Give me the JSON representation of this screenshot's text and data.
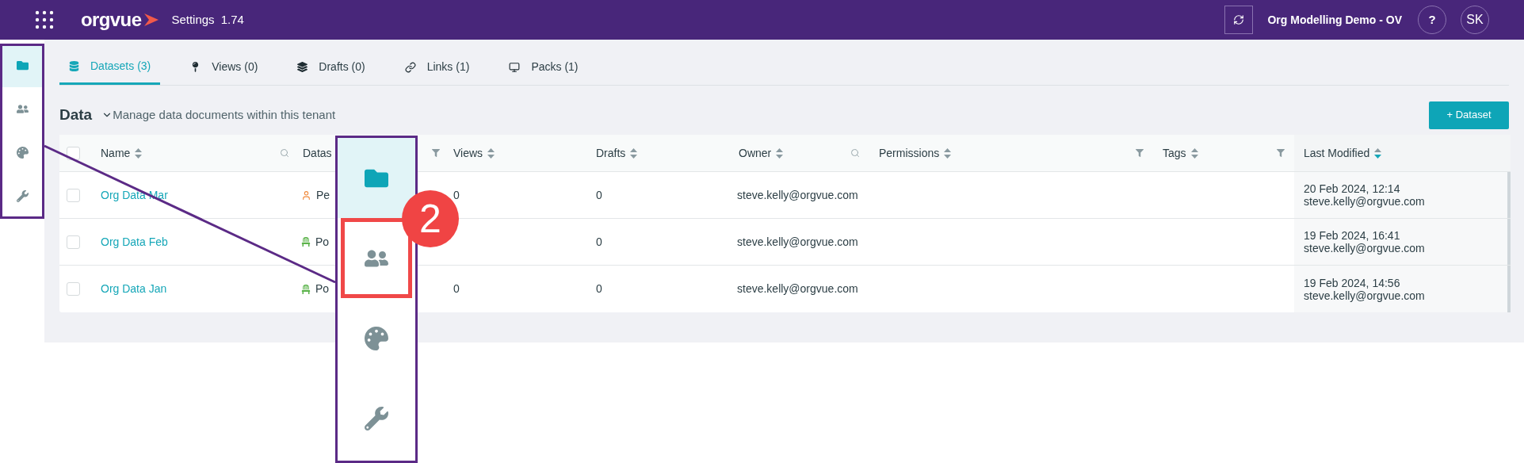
{
  "top_bar": {
    "app_name": "orgvue",
    "title": "Settings",
    "version": "1.74",
    "workspace": "Org Modelling Demo - OV",
    "help": "?",
    "avatar": "SK"
  },
  "sidebar": {
    "items": [
      {
        "kind": "folder",
        "selected": true
      },
      {
        "kind": "people",
        "selected": false
      },
      {
        "kind": "palette",
        "selected": false
      },
      {
        "kind": "wrench",
        "selected": false
      }
    ]
  },
  "tabs": [
    {
      "kind": "database",
      "label": "Datasets (3)",
      "selected": true
    },
    {
      "kind": "pin",
      "label": "Views (0)",
      "selected": false
    },
    {
      "kind": "layers",
      "label": "Drafts (0)",
      "selected": false
    },
    {
      "kind": "link",
      "label": "Links (1)",
      "selected": false
    },
    {
      "kind": "pack",
      "label": "Packs (1)",
      "selected": false
    }
  ],
  "heading": {
    "title": "Data",
    "description": "Manage data documents within this tenant"
  },
  "add_button": "+ Dataset",
  "table": {
    "select_all_checked": false,
    "columns": [
      {
        "label": "Name",
        "kind": "search",
        "sorted": false
      },
      {
        "label": "Datas",
        "kind": "filter"
      },
      {
        "label": "Views",
        "kind": "plain",
        "sorted": false
      },
      {
        "label": "Drafts",
        "kind": "plain",
        "sorted": false
      },
      {
        "label": "Owner",
        "kind": "search",
        "sorted": false
      },
      {
        "label": "Permissions",
        "kind": "filter",
        "sorted": false
      },
      {
        "label": "Tags",
        "kind": "filter",
        "sorted": false
      },
      {
        "label": "Last Modified",
        "kind": "plain",
        "sorted": true
      }
    ],
    "rows": [
      {
        "checked": false,
        "name": "Org Data Mar",
        "kind": "person",
        "type": "Pe",
        "views": "0",
        "drafts": "0",
        "owner": "steve.kelly@orgvue.com",
        "modified_date": "20 Feb 2024, 12:14",
        "modified_by": "steve.kelly@orgvue.com"
      },
      {
        "checked": false,
        "name": "Org Data Feb",
        "kind": "position",
        "type": "Po",
        "drafts": "0",
        "owner": "steve.kelly@orgvue.com",
        "modified_date": "19 Feb 2024, 16:41",
        "modified_by": "steve.kelly@orgvue.com"
      },
      {
        "checked": false,
        "name": "Org Data Jan",
        "kind": "position",
        "type": "Po",
        "views": "0",
        "drafts": "0",
        "owner": "steve.kelly@orgvue.com",
        "modified_date": "19 Feb 2024, 14:56",
        "modified_by": "steve.kelly@orgvue.com"
      }
    ]
  },
  "callout": {
    "badge": "2",
    "items": [
      {
        "kind": "folder",
        "selected": true,
        "highlighted": false
      },
      {
        "kind": "people",
        "selected": false,
        "highlighted": true
      },
      {
        "kind": "palette",
        "selected": false,
        "highlighted": false
      },
      {
        "kind": "wrench",
        "selected": false,
        "highlighted": false
      }
    ]
  }
}
